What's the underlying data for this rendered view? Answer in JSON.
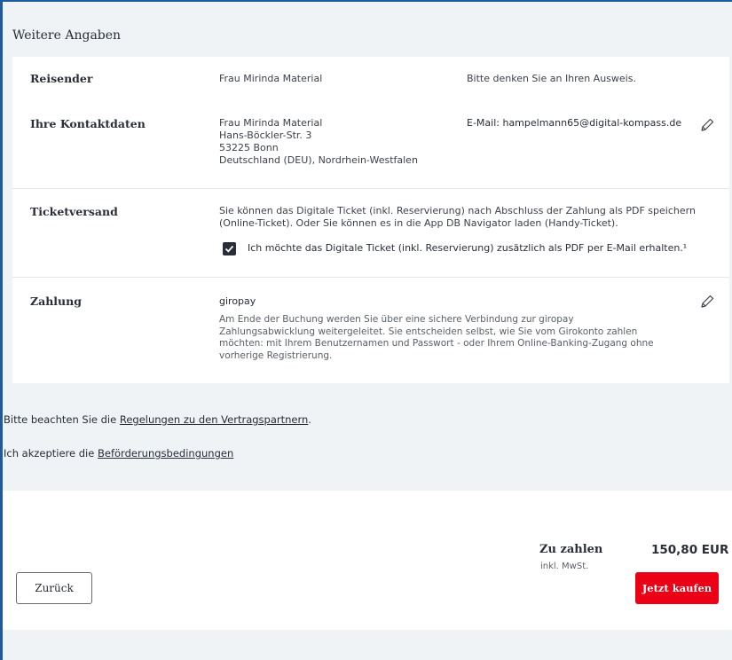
{
  "section_title": "Weitere Angaben",
  "reisender": {
    "label": "Reisender",
    "name": "Frau Mirinda Material",
    "hint": "Bitte denken Sie an Ihren Ausweis."
  },
  "kontakt": {
    "label": "Ihre Kontaktdaten",
    "address_lines": [
      "Frau Mirinda Material",
      "Hans-Böckler-Str. 3",
      "53225 Bonn",
      "Deutschland (DEU), Nordrhein-Westfalen"
    ],
    "email": "E-Mail: hampelmann65@digital-kompass.de",
    "edit_icon": "pencil-icon"
  },
  "ticketversand": {
    "label": "Ticketversand",
    "description_line1": "Sie können das Digitale Ticket (inkl. Reservierung) nach Abschluss der Zahlung als PDF speichern",
    "description_line2": "(Online-Ticket). Oder Sie können es in die App DB Navigator laden (Handy-Ticket).",
    "checkbox_label": "Ich möchte das Digitale Ticket (inkl. Reservierung) zusätzlich als PDF per E-Mail erhalten.¹",
    "checkbox_checked": true
  },
  "zahlung": {
    "label": "Zahlung",
    "method": "giropay",
    "desc_lines": [
      "Am Ende der Buchung werden Sie über eine sichere Verbindung zur giropay",
      "Zahlungsabwicklung weitergeleitet. Sie entscheiden selbst, wie Sie vom Girokonto zahlen",
      "möchten: mit Ihrem Benutzernamen und Passwort - oder Ihrem Online-Banking-Zugang ohne",
      "vorherige Registrierung."
    ],
    "edit_icon": "pencil-icon"
  },
  "notices": {
    "regelungen_prefix": "Bitte beachten Sie die ",
    "regelungen_link": "Regelungen zu den Vertragspartnern",
    "regelungen_suffix": ".",
    "bedingungen_prefix": "Ich akzeptiere die ",
    "bedingungen_link": "Beförderungsbedingungen"
  },
  "summary": {
    "label": "Zu zahlen",
    "sub": "inkl. MwSt.",
    "amount": "150,80 EUR"
  },
  "buttons": {
    "back": "Zurück",
    "buy": "Jetzt kaufen"
  },
  "colors": {
    "accent_red": "#ec0016",
    "frame_blue": "#1e5aa0"
  }
}
